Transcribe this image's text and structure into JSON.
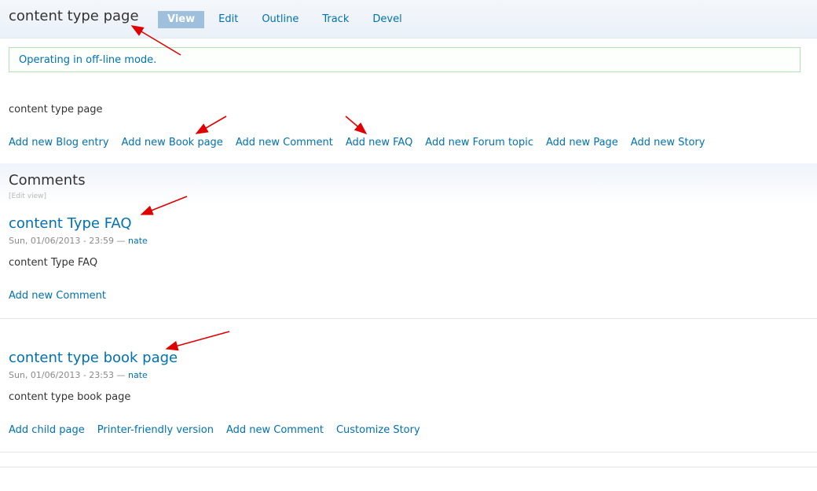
{
  "header": {
    "title": "content type page",
    "tabs": [
      {
        "label": "View",
        "active": true
      },
      {
        "label": "Edit"
      },
      {
        "label": "Outline"
      },
      {
        "label": "Track"
      },
      {
        "label": "Devel"
      }
    ]
  },
  "status": {
    "message": "Operating in off-line mode."
  },
  "node": {
    "body": "content type page",
    "links": [
      "Add new Blog entry",
      "Add new Book page",
      "Add new Comment",
      "Add new FAQ",
      "Add new Forum topic",
      "Add new Page",
      "Add new Story"
    ]
  },
  "comments": {
    "heading": "Comments",
    "edit_view": "[Edit view]",
    "items": [
      {
        "title": "content Type FAQ",
        "date": "Sun, 01/06/2013 - 23:59",
        "separator": "—",
        "author": "nate",
        "body": "content Type FAQ",
        "links": [
          "Add new Comment"
        ]
      },
      {
        "title": "content type book page",
        "date": "Sun, 01/06/2013 - 23:53",
        "separator": "—",
        "author": "nate",
        "body": "content type book page",
        "links": [
          "Add child page",
          "Printer-friendly version",
          "Add new Comment",
          "Customize Story"
        ]
      }
    ]
  },
  "colors": {
    "link": "#0071b3",
    "active_tab": "#9ec0dd",
    "annotation_arrow": "#e00000"
  }
}
